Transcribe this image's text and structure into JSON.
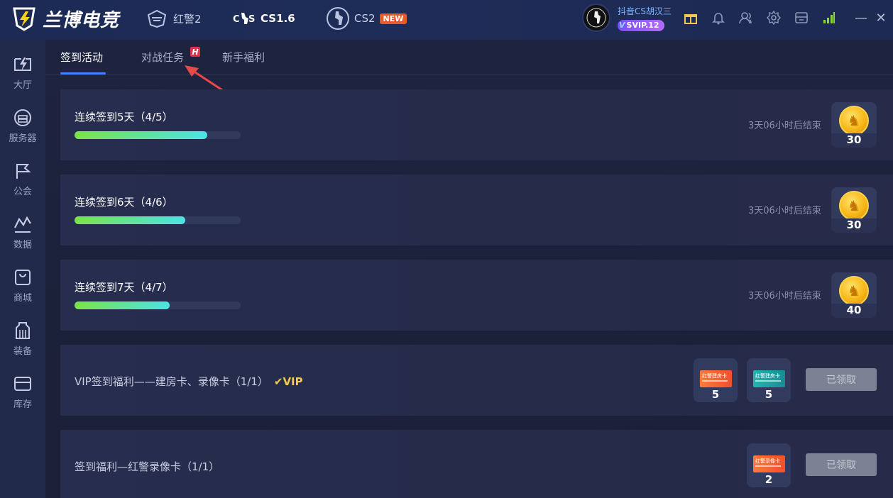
{
  "app": {
    "brand": "兰博电竞"
  },
  "game_tabs": [
    {
      "label": "红警2",
      "icon": "red-alert-icon"
    },
    {
      "label": "CS1.6",
      "icon": "cs-icon"
    },
    {
      "label": "CS2",
      "icon": "cs2-icon",
      "badge": "NEW"
    }
  ],
  "user": {
    "name": "抖音CS胡汉三",
    "vip": "SVIP.12"
  },
  "top_icons": [
    "gift-icon",
    "bell-icon",
    "friends-icon",
    "settings-icon",
    "mail-icon",
    "signal-icon"
  ],
  "window": {
    "minimize": "—",
    "close": "✕"
  },
  "sidebar": {
    "items": [
      {
        "label": "大厅",
        "icon": "lobby-icon"
      },
      {
        "label": "服务器",
        "icon": "server-icon"
      },
      {
        "label": "公会",
        "icon": "guild-flag-icon"
      },
      {
        "label": "数据",
        "icon": "data-chart-icon"
      },
      {
        "label": "商城",
        "icon": "shop-bag-icon"
      },
      {
        "label": "装备",
        "icon": "equipment-icon"
      },
      {
        "label": "库存",
        "icon": "inventory-icon"
      }
    ]
  },
  "subtabs": {
    "items": [
      {
        "label": "签到活动",
        "active": true
      },
      {
        "label": "对战任务",
        "badge": "H"
      },
      {
        "label": "新手福利"
      }
    ]
  },
  "tasks": [
    {
      "title": "连续签到5天（4/5）",
      "progress": 0.8,
      "ends": "3天06小时后结束",
      "reward": "30"
    },
    {
      "title": "连续签到6天（4/6）",
      "progress": 0.667,
      "ends": "3天06小时后结束",
      "reward": "30"
    },
    {
      "title": "连续签到7天（4/7）",
      "progress": 0.571,
      "ends": "3天06小时后结束",
      "reward": "40"
    }
  ],
  "vip_task": {
    "title": "VIP签到福利——建房卡、录像卡（1/1）",
    "vip_tag": "VIP",
    "rewards": [
      {
        "card_text": "红警建房卡",
        "amount": "5",
        "color": "#f0602f"
      },
      {
        "card_text": "红警建房卡",
        "amount": "5",
        "color": "#1aa6a6"
      }
    ],
    "button": "已领取"
  },
  "signin_task": {
    "title": "签到福利—红警录像卡（1/1）",
    "rewards": [
      {
        "card_text": "红警录像卡",
        "amount": "2",
        "color": "#f0602f"
      }
    ],
    "button": "已领取"
  }
}
